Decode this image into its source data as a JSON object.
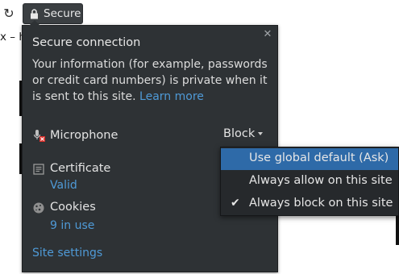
{
  "toolbar": {
    "reload_icon": "reload-icon",
    "url_chip": {
      "lock_icon": "lock-icon",
      "label": "Secure"
    },
    "tab_fragment": "x – h"
  },
  "panel": {
    "title": "Secure connection",
    "info_text": "Your information (for example, passwords or credit card numbers) is private when it is sent to this site.",
    "learn_more": "Learn more",
    "close_icon": "close-icon",
    "permissions": {
      "microphone": {
        "icon": "microphone-blocked-icon",
        "label": "Microphone",
        "value": "Block"
      }
    },
    "certificate": {
      "icon": "certificate-icon",
      "label": "Certificate",
      "value": "Valid"
    },
    "cookies": {
      "icon": "cookie-icon",
      "label": "Cookies",
      "value": "9 in use"
    },
    "site_settings": "Site settings"
  },
  "dropdown": {
    "items": [
      {
        "label": "Use global default (Ask)",
        "highlighted": true,
        "checked": false
      },
      {
        "label": "Always allow on this site",
        "highlighted": false,
        "checked": false
      },
      {
        "label": "Always block on this site",
        "highlighted": false,
        "checked": true
      }
    ],
    "check_glyph": "✔"
  },
  "colors": {
    "panel_bg": "#2e3235",
    "link": "#4f9ad7",
    "menu_bg": "#26292c",
    "menu_highlight": "#2e6aa8",
    "blocked_red": "#d9302b"
  }
}
